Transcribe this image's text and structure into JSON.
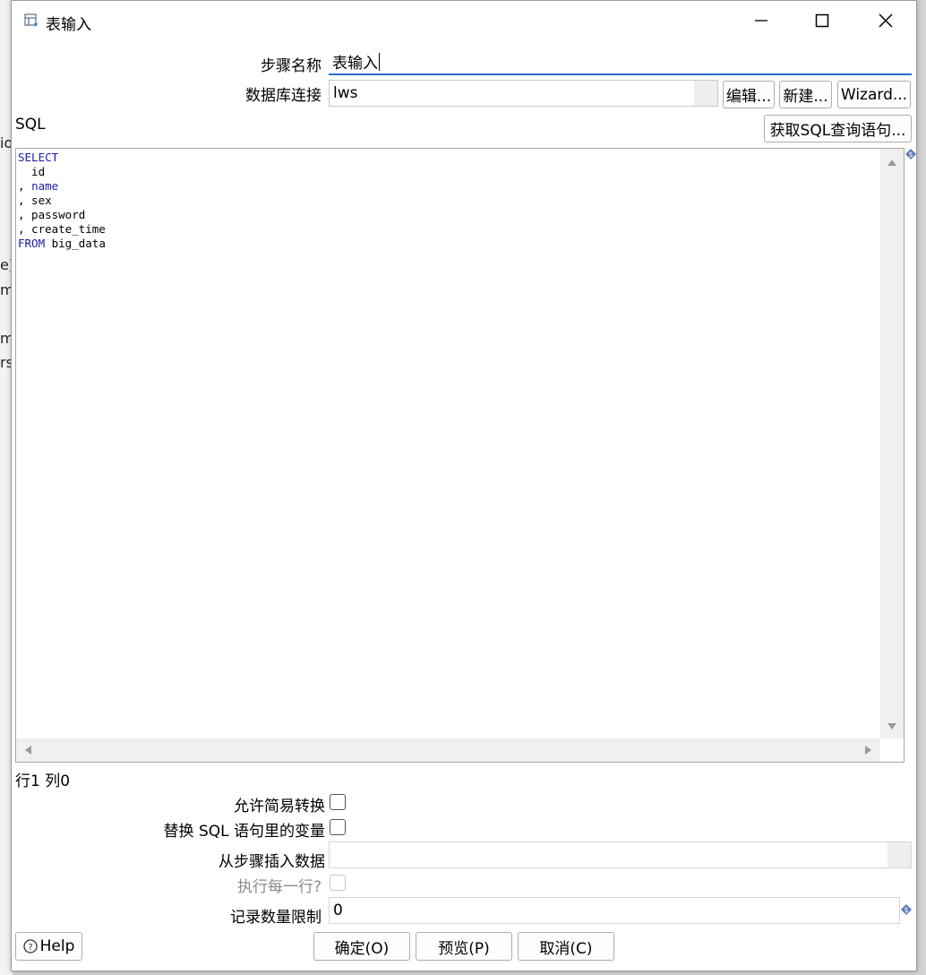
{
  "background": {
    "side_chars": [
      "io",
      "e)",
      "m",
      "m",
      "rs"
    ]
  },
  "window": {
    "title": "表输入",
    "controls": {
      "minimize": "—",
      "maximize": "☐",
      "close": "✕"
    }
  },
  "form": {
    "step_name_label": "步骤名称",
    "step_name_value": "表输入",
    "db_connection_label": "数据库连接",
    "db_connection_value": "lws",
    "edit_button": "编辑...",
    "new_button": "新建...",
    "wizard_button": "Wizard...",
    "sql_label": "SQL",
    "get_sql_button": "获取SQL查询语句...",
    "sql_lines": [
      {
        "kw": "SELECT",
        "rest": ""
      },
      {
        "kw": "",
        "rest": "  id"
      },
      {
        "kw": "",
        "rest": ", ",
        "kw2": "name"
      },
      {
        "kw": "",
        "rest": ", sex"
      },
      {
        "kw": "",
        "rest": ", password"
      },
      {
        "kw": "",
        "rest": ", create_time"
      },
      {
        "kw": "FROM",
        "rest": " big_data"
      }
    ],
    "cursor_position": "行1 列0",
    "lazy_conversion_label": "允许简易转换",
    "replace_vars_label": "替换 SQL 语句里的变量",
    "insert_from_step_label": "从步骤插入数据",
    "insert_from_step_value": "",
    "execute_each_row_label": "执行每一行?",
    "limit_label": "记录数量限制",
    "limit_value": "0"
  },
  "footer": {
    "help_button": "Help",
    "ok_button": "确定(O)",
    "preview_button": "预览(P)",
    "cancel_button": "取消(C)"
  }
}
